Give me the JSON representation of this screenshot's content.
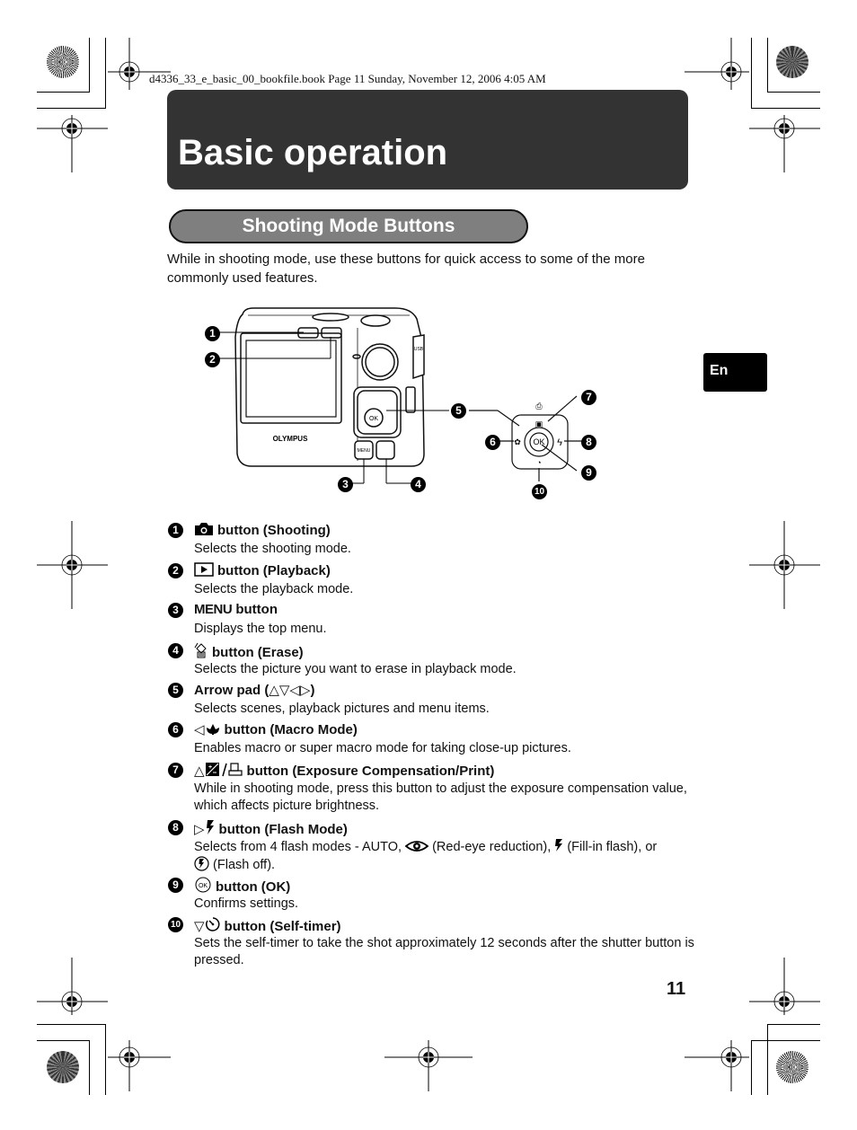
{
  "print_header": "d4336_33_e_basic_00_bookfile.book  Page 11  Sunday, November 12, 2006  4:05 AM",
  "title": "Basic operation",
  "section": {
    "title": "Shooting Mode Buttons",
    "intro": "While in shooting mode, use these buttons for quick access to some of the more commonly used features."
  },
  "language_tab": "En",
  "page_number": "11",
  "figure": {
    "brand": "OLYMPUS",
    "ok_label": "OK",
    "menu_label": "MENU",
    "port_label": "USB A/V OUT",
    "callouts": [
      "1",
      "2",
      "3",
      "4",
      "5",
      "6",
      "7",
      "8",
      "9",
      "10"
    ]
  },
  "items": [
    {
      "num": "1",
      "icon": "camera-icon",
      "head": "button (Shooting)",
      "desc": "Selects the shooting mode."
    },
    {
      "num": "2",
      "icon": "playback-icon",
      "head": "button (Playback)",
      "desc": "Selects the playback mode."
    },
    {
      "num": "3",
      "icon": "",
      "head_prefix": "MENU",
      "head": "button",
      "desc": "Displays the top menu."
    },
    {
      "num": "4",
      "icon": "erase-icon",
      "head": "button (Erase)",
      "desc": "Selects the picture you want to erase in playback mode."
    },
    {
      "num": "5",
      "icon": "",
      "head": "Arrow pad (",
      "head_symbols": "△▽◁▷",
      "head_suffix": ")",
      "desc": "Selects scenes, playback pictures and menu items."
    },
    {
      "num": "6",
      "icon": "macro-icon",
      "head_symbols": "◁",
      "head": "button (Macro Mode)",
      "desc": "Enables macro or super macro mode for taking close-up pictures."
    },
    {
      "num": "7",
      "icon": "exposure-print-icon",
      "head_symbols": "△",
      "head": "button (Exposure Compensation/Print)",
      "desc": "While in shooting mode, press this button to adjust the exposure compensation value, which affects picture brightness."
    },
    {
      "num": "8",
      "icon": "flash-icon",
      "head_symbols": "▷",
      "head": "button (Flash Mode)",
      "desc_parts": [
        "Selects from 4 flash modes - AUTO,",
        "(Red-eye reduction),",
        "(Fill-in flash), or",
        "(Flash off)."
      ]
    },
    {
      "num": "9",
      "icon": "ok-icon",
      "head": "button (OK)",
      "desc": "Confirms settings."
    },
    {
      "num": "10",
      "icon": "self-timer-icon",
      "head_symbols": "▽",
      "head": "button (Self-timer)",
      "desc": "Sets the self-timer to take the shot approximately 12 seconds after the shutter button is pressed."
    }
  ]
}
